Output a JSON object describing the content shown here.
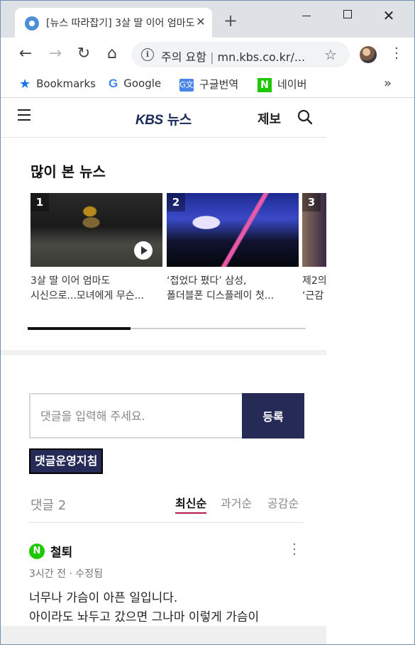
{
  "browser": {
    "tab": {
      "title": "[뉴스 따라잡기] 3살 딸 이어 엄마도 시신으로"
    },
    "window_controls": {
      "minimize": "minimize-icon",
      "maximize": "maximize-icon",
      "close": "close-icon"
    },
    "omnibox": {
      "security_label": "주의 요함",
      "separator": "|",
      "url": "mn.kbs.co.kr/..."
    },
    "bookmarks": [
      {
        "label": "Bookmarks",
        "icon": "star-icon"
      },
      {
        "label": "Google",
        "icon": "google-icon"
      },
      {
        "label": "구글번역",
        "icon": "google-translate-icon"
      },
      {
        "label": "네이버",
        "icon": "naver-icon"
      }
    ],
    "bookmarks_more": "»"
  },
  "site": {
    "logo_main": "KBS",
    "logo_sub": "뉴스",
    "report_label": "제보"
  },
  "popular": {
    "title": "많이 본 뉴스",
    "items": [
      {
        "rank": "1",
        "line1": "3살 딸 이어 엄마도",
        "line2": "시신으로...모녀에게 무슨..."
      },
      {
        "rank": "2",
        "line1": "‘접었다 폈다’ 삼성,",
        "line2": "폴더블폰 디스플레이 첫..."
      },
      {
        "rank": "3",
        "line1": "제2의",
        "line2": "‘근감"
      }
    ],
    "scroll_progress": 0.37
  },
  "comments": {
    "input_placeholder": "댓글을 입력해 주세요.",
    "submit_label": "등록",
    "policy_label": "댓글운영지침",
    "count_label": "댓글",
    "count": "2",
    "sort_new": "최신순",
    "sort_old": "과거순",
    "sort_like": "공감순",
    "items": [
      {
        "author": "철퇴",
        "meta": "3시간 전 · 수정됨",
        "line1": "너무나 가슴이 아픈 일입니다.",
        "line2": "아이라도 놔두고 갔으면 그나마 이렇게 가슴이"
      }
    ]
  }
}
